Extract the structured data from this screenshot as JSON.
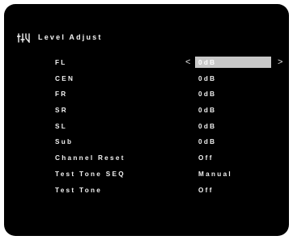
{
  "header": {
    "icon": "level-adjust-icon",
    "title": "Level Adjust"
  },
  "menu": {
    "selected_index": 0,
    "arrow_left": "<",
    "arrow_right": ">",
    "items": [
      {
        "label": "FL",
        "value": "0dB"
      },
      {
        "label": "CEN",
        "value": "0dB"
      },
      {
        "label": "FR",
        "value": "0dB"
      },
      {
        "label": "SR",
        "value": "0dB"
      },
      {
        "label": "SL",
        "value": "0dB"
      },
      {
        "label": "Sub",
        "value": "0dB"
      },
      {
        "label": "Channel Reset",
        "value": "Off"
      },
      {
        "label": "Test Tone SEQ",
        "value": "Manual"
      },
      {
        "label": "Test Tone",
        "value": "Off"
      }
    ]
  },
  "colors": {
    "background": "#000000",
    "text": "#f2f2f2",
    "highlight": "#c8c8c8"
  }
}
